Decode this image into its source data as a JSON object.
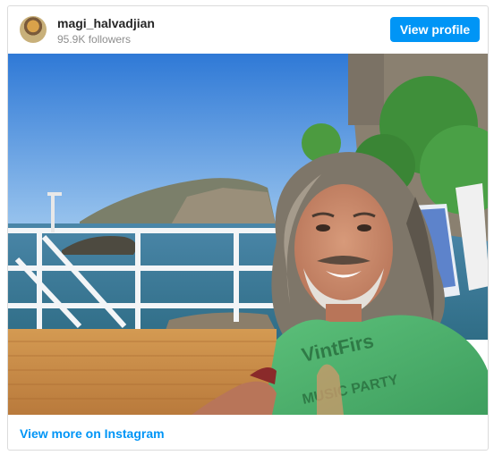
{
  "post": {
    "username": "magi_halvadjian",
    "followers": "95.9K followers",
    "view_profile_label": "View profile",
    "view_more_label": "View more on Instagram",
    "photo_description": "Selfie of a smiling man with long gray hair in a green t-shirt on a seaside terrace",
    "shirt_text": "VintFirs",
    "shirt_text2": "MUSIC PARTY"
  },
  "colors": {
    "accent": "#0095f6",
    "username": "#262626",
    "muted": "#8e8e8e"
  }
}
